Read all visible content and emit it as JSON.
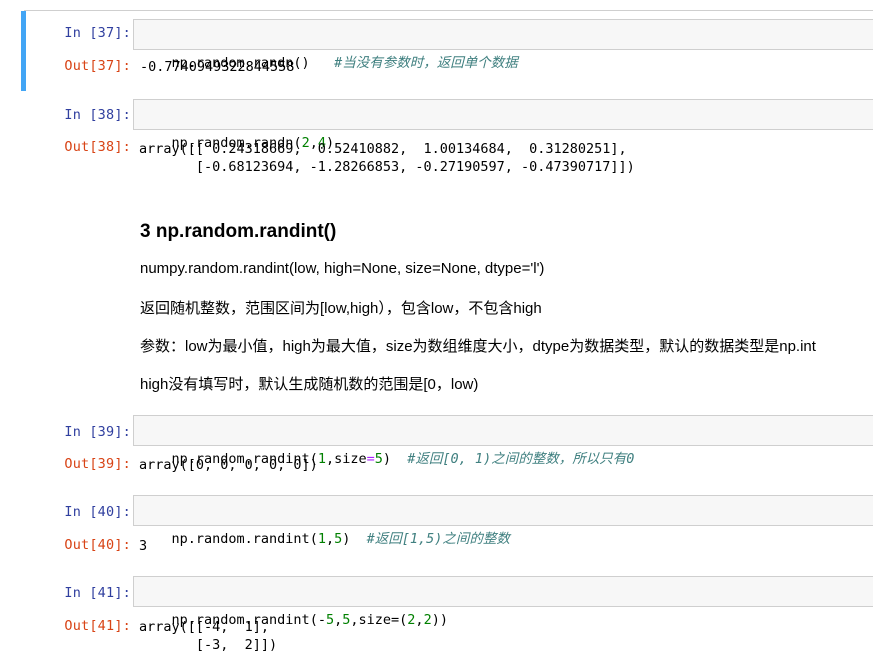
{
  "cells": [
    {
      "in_prompt": "In  [37]:",
      "code_parts": [
        "np.random.randn()",
        "   ",
        "#当没有参数时，返回单个数据"
      ],
      "out_prompt": "Out[37]:",
      "output": "-0.7740949322844558"
    },
    {
      "in_prompt": "In  [38]:",
      "code_parts": [
        "np.random.randn",
        "(",
        "2",
        ",",
        "4",
        ")"
      ],
      "out_prompt": "Out[38]:",
      "output_lines": [
        "array([[ 0.24318669,  0.52410882,  1.00134684,  0.31280251],",
        "       [-0.68123694, -1.28266853, -0.27190597, -0.47390717]])"
      ]
    },
    {
      "in_prompt": "In  [39]:",
      "code_parts": [
        "np.random.randint",
        "(",
        "1",
        ",size",
        "=",
        "5",
        ")",
        "  ",
        "#返回[0, 1)之间的整数，所以只有0"
      ],
      "out_prompt": "Out[39]:",
      "output": "array([0, 0, 0, 0, 0])"
    },
    {
      "in_prompt": "In  [40]:",
      "code_parts": [
        "np.random.randint",
        "(",
        "1",
        ",",
        "5",
        ")",
        "  ",
        "#返回[1,5)之间的整数"
      ],
      "out_prompt": "Out[40]:",
      "output": "3"
    },
    {
      "in_prompt": "In  [41]:",
      "code_parts": [
        "np.random.randint",
        "(-",
        "5",
        ",",
        "5",
        ",size",
        "=(",
        "2",
        ",",
        "2",
        "))"
      ],
      "out_prompt": "Out[41]:",
      "output_lines": [
        "array([[-4,  1],",
        "       [-3,  2]])"
      ]
    }
  ],
  "markdown": {
    "heading": "3 np.random.randint()",
    "p1": "numpy.random.randint(low, high=None, size=None, dtype='l')",
    "p2": "返回随机整数，范围区间为[low,high），包含low，不包含high",
    "p3": "参数：low为最小值，high为最大值，size为数组维度大小，dtype为数据类型，默认的数据类型是np.int",
    "p4": "high没有填写时，默认生成随机数的范围是[0，low)"
  },
  "colors": {
    "in_prompt": "#303f9f",
    "out_prompt": "#d84315",
    "selected_bar": "#42a5f5",
    "comment": "#408080",
    "number": "#008000",
    "operator": "#aa22ff"
  }
}
